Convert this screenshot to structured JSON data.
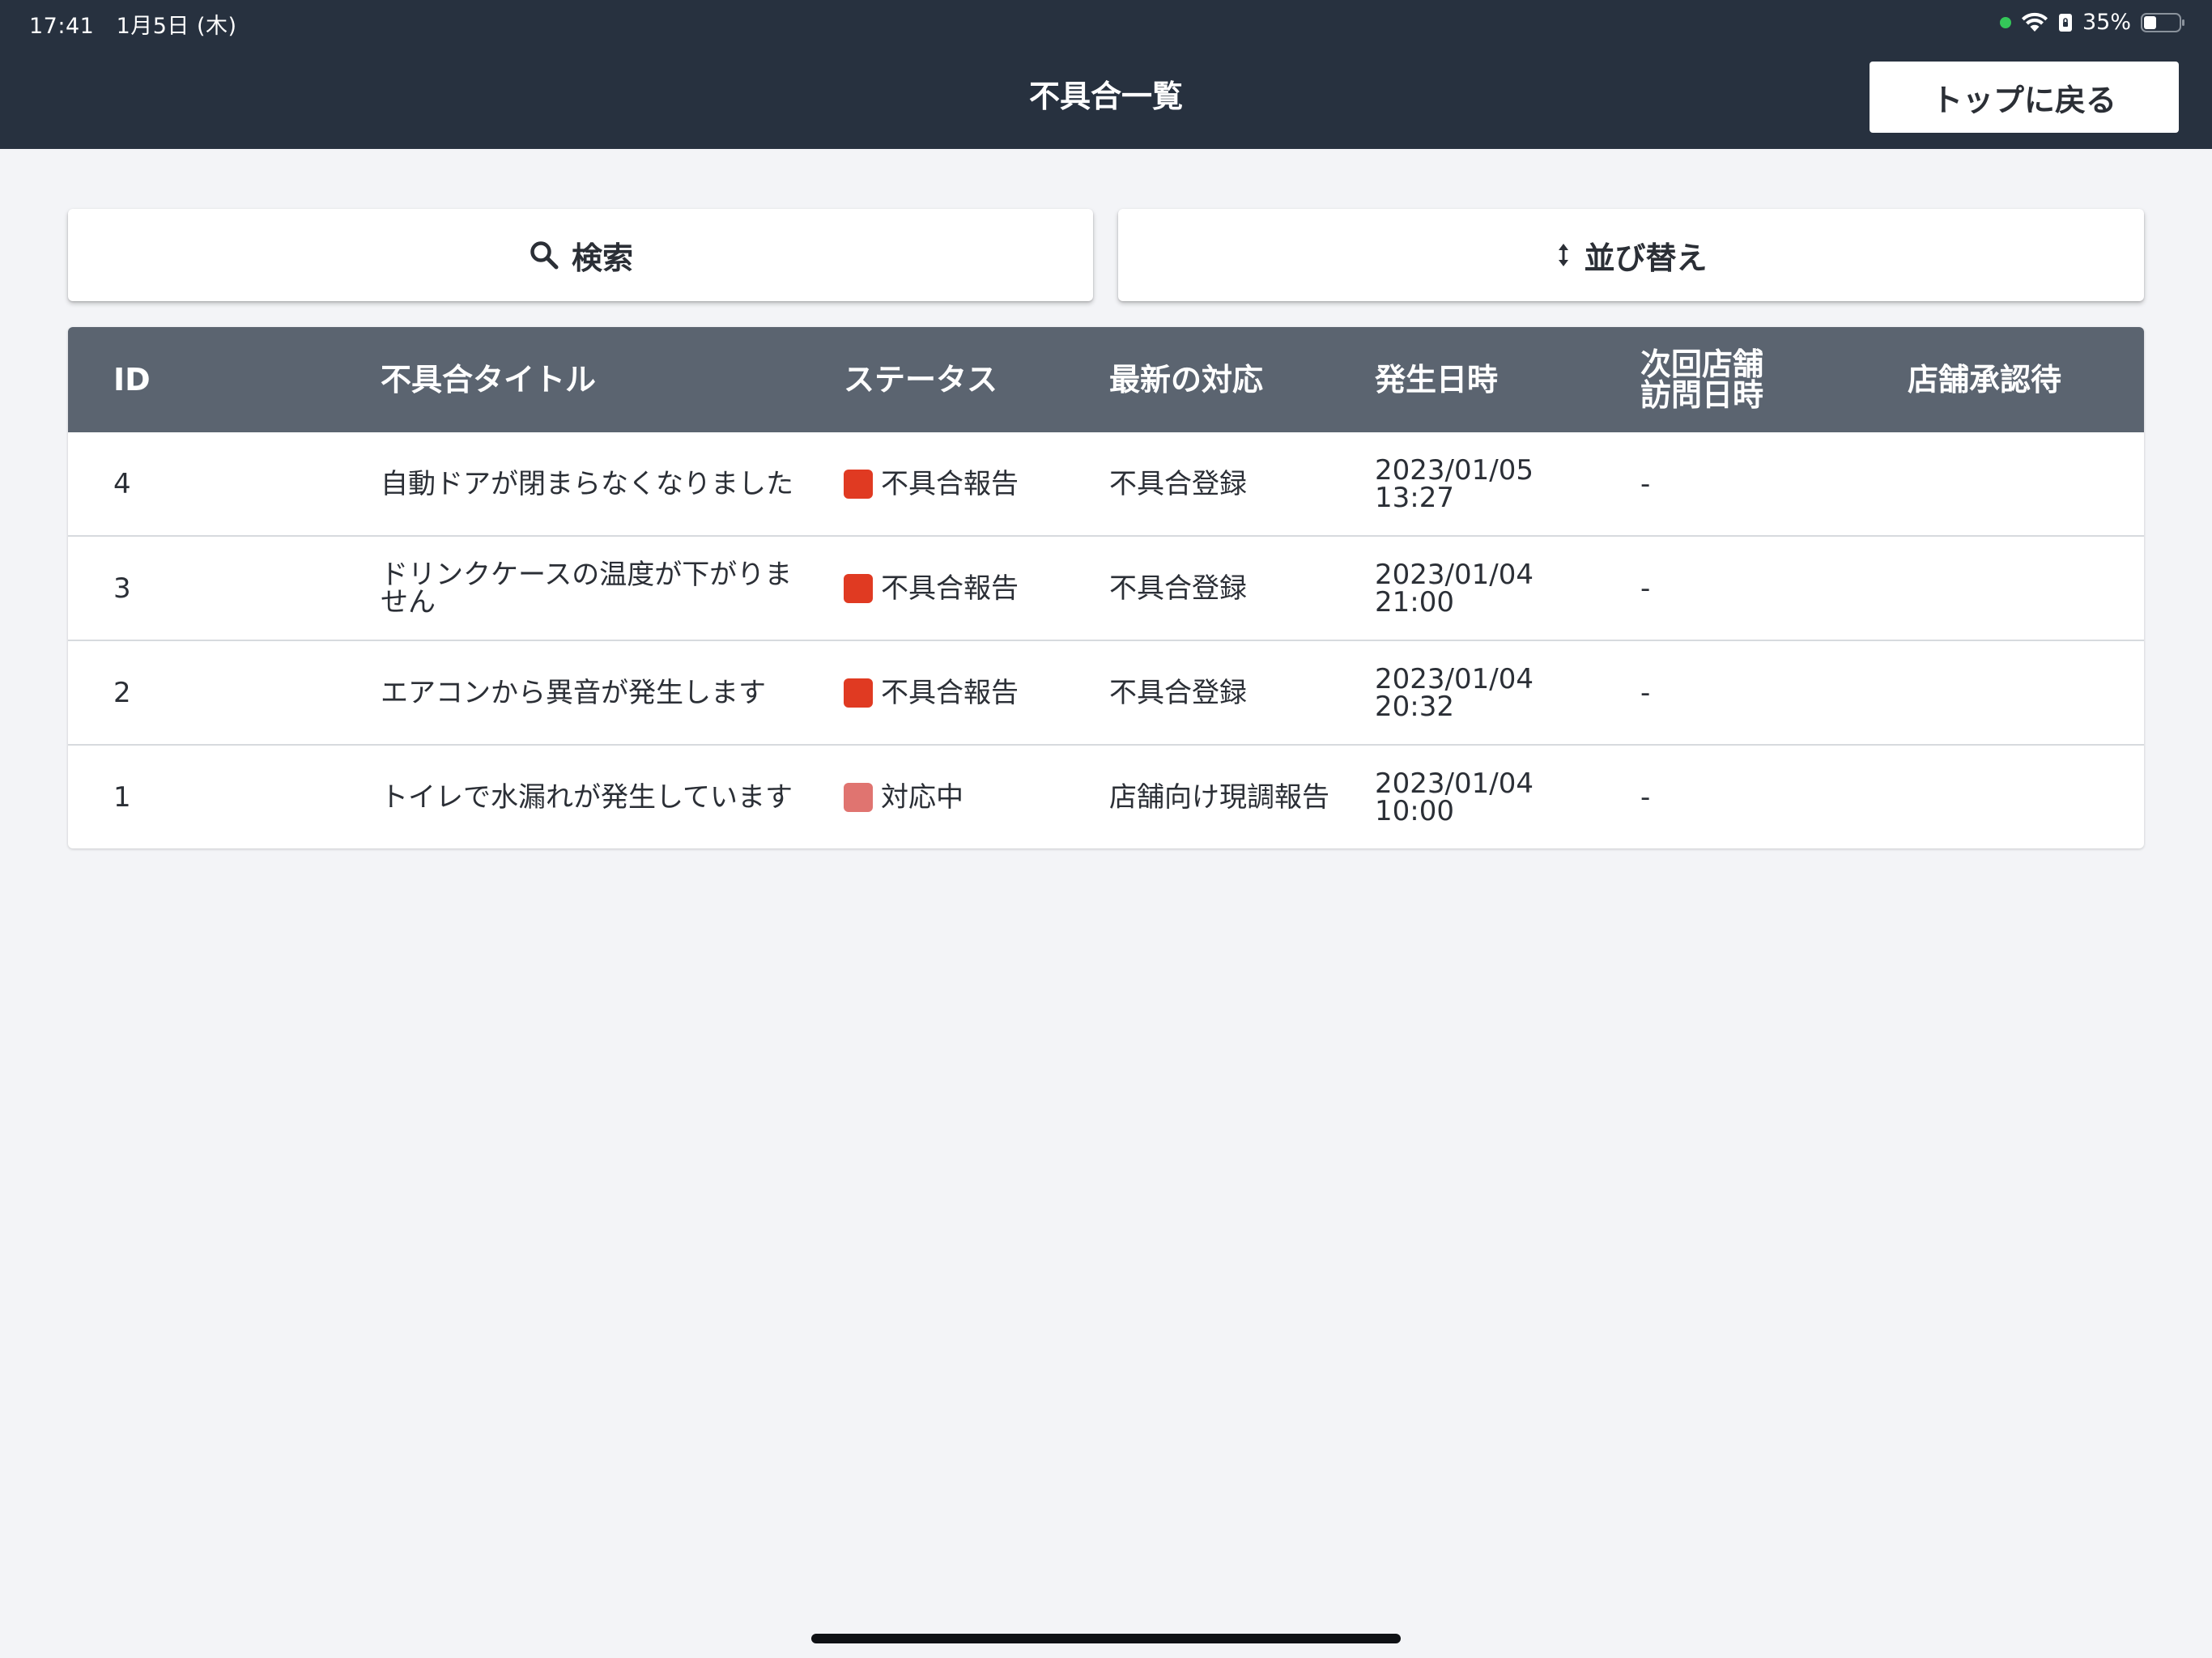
{
  "status_bar": {
    "time": "17:41",
    "date": "1月5日 (木)",
    "battery": "35%"
  },
  "header": {
    "title": "不具合一覧",
    "back_label": "トップに戻る"
  },
  "actions": {
    "search_label": "検索",
    "sort_label": "並び替え"
  },
  "table": {
    "columns": [
      "ID",
      "不具合タイトル",
      "ステータス",
      "最新の対応",
      "発生日時",
      "次回店舗\n訪問日時",
      "店舗承認待"
    ],
    "rows": [
      {
        "id": "4",
        "title": "自動ドアが閉まらなくなりました",
        "status": "不具合報告",
        "status_color": "#e03a22",
        "latest": "不具合登録",
        "date": "2023/01/05",
        "time": "13:27",
        "next_visit": "-",
        "approval": ""
      },
      {
        "id": "3",
        "title": "ドリンクケースの温度が下がりません",
        "status": "不具合報告",
        "status_color": "#e03a22",
        "latest": "不具合登録",
        "date": "2023/01/04",
        "time": "21:00",
        "next_visit": "-",
        "approval": ""
      },
      {
        "id": "2",
        "title": "エアコンから異音が発生します",
        "status": "不具合報告",
        "status_color": "#e03a22",
        "latest": "不具合登録",
        "date": "2023/01/04",
        "time": "20:32",
        "next_visit": "-",
        "approval": ""
      },
      {
        "id": "1",
        "title": "トイレで水漏れが発生しています",
        "status": "対応中",
        "status_color": "#e07470",
        "latest": "店舗向け現調報告",
        "date": "2023/01/04",
        "time": "10:00",
        "next_visit": "-",
        "approval": ""
      }
    ]
  },
  "colors": {
    "header_bg": "#27313f",
    "table_header_bg": "#5b6470",
    "page_bg": "#f3f4f7"
  }
}
